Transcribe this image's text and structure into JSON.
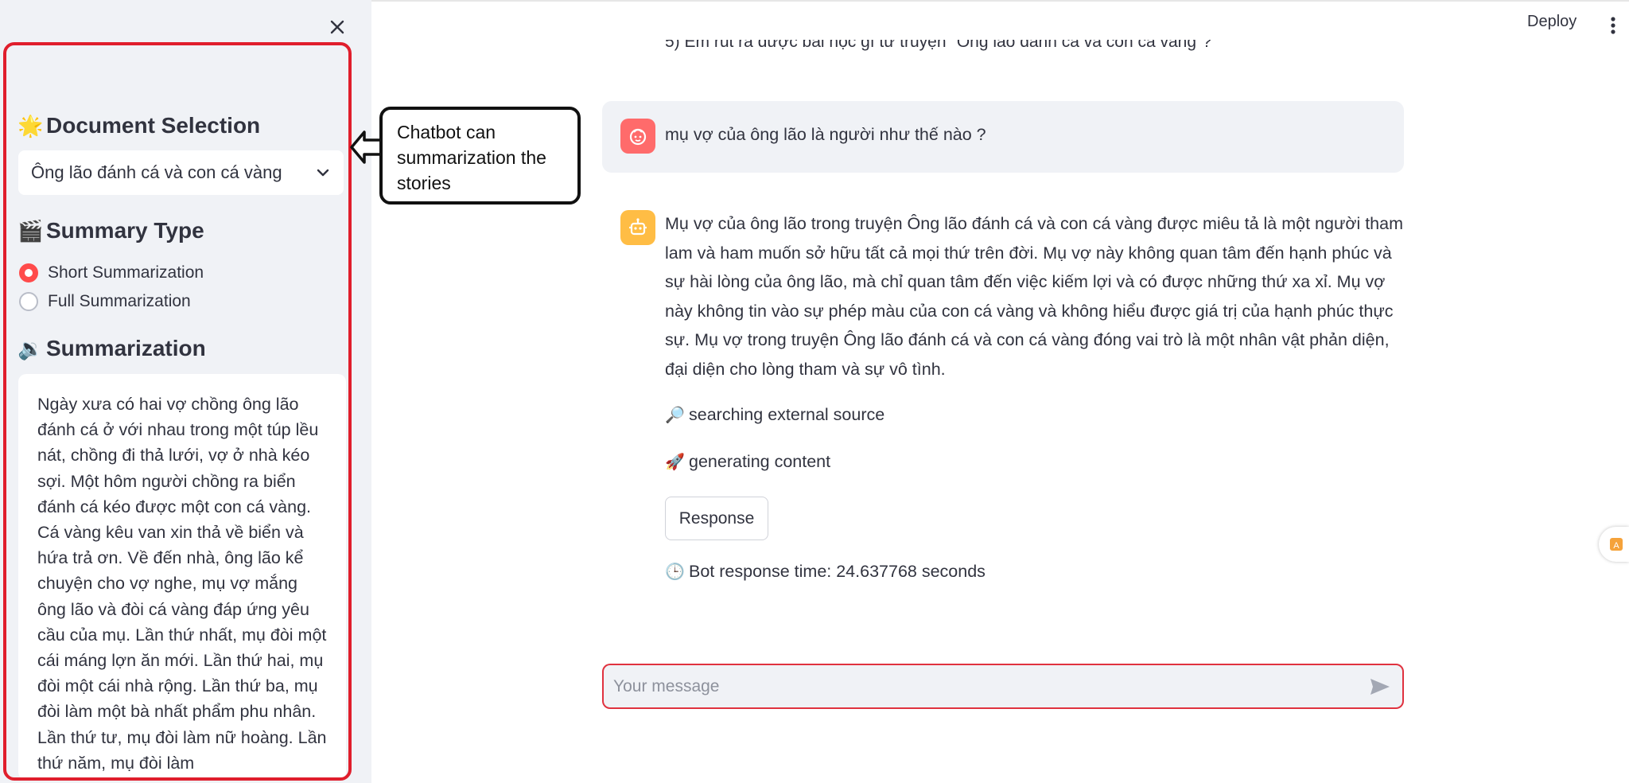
{
  "sidebar": {
    "document_heading": "Document Selection",
    "document_emoji": "🌟",
    "selected_document": "Ông lão đánh cá và con cá vàng",
    "summary_type_heading": "Summary Type",
    "summary_type_emoji": "🎬",
    "summary_type_options": [
      "Short Summarization",
      "Full Summarization"
    ],
    "summary_type_selected": "Short Summarization",
    "summarization_heading": "Summarization",
    "summarization_emoji": "🔉",
    "summary_text": "Ngày xưa có hai vợ chồng ông lão đánh cá ở với nhau trong một túp lều nát, chồng đi thả lưới, vợ ở nhà kéo sợi. Một hôm người chồng ra biển đánh cá kéo được một con cá vàng. Cá vàng kêu van xin thả về biển và hứa trả ơn. Về đến nhà, ông lão kể chuyện cho vợ nghe, mụ vợ mắng ông lão và đòi cá vàng đáp ứng yêu cầu của mụ. Lần thứ nhất, mụ đòi một cái máng lợn ăn mới. Lần thứ hai, mụ đòi một cái nhà rộng. Lần thứ ba, mụ đòi làm một bà nhất phẩm phu nhân. Lần thứ tư, mụ đòi làm nữ hoàng. Lần thứ năm, mụ đòi làm"
  },
  "header": {
    "deploy_label": "Deploy"
  },
  "chat": {
    "previous_line": "5) Em rút ra được bài học gì từ truyện \"Ông lão đánh cá và con cá vàng\"?",
    "user_message": "mụ vợ của ông lão là người như thế nào ?",
    "bot_message": "Mụ vợ của ông lão trong truyện Ông lão đánh cá và con cá vàng được miêu tả là một người tham lam và ham muốn sở hữu tất cả mọi thứ trên đời. Mụ vợ này không quan tâm đến hạnh phúc và sự hài lòng của ông lão, mà chỉ quan tâm đến việc kiếm lợi và có được những thứ xa xỉ. Mụ vợ này không tin vào sự phép màu của con cá vàng và không hiểu được giá trị của hạnh phúc thực sự. Mụ vợ trong truyện Ông lão đánh cá và con cá vàng đóng vai trò là một nhân vật phản diện, đại diện cho lòng tham và sự vô tình.",
    "status_searching": "searching external source",
    "status_searching_emoji": "🔎",
    "status_generating": "generating content",
    "status_generating_emoji": "🚀",
    "response_button": "Response",
    "response_time": "Bot response time: 24.637768 seconds",
    "response_time_emoji": "🕒",
    "input_placeholder": "Your message"
  },
  "annotation": {
    "callout_text": "Chatbot can summarization the stories"
  },
  "colors": {
    "accent": "#ff4b4b",
    "highlight": "#e01e2c",
    "sidebar_bg": "#f0f2f6",
    "user_avatar": "#ff6b6b",
    "bot_avatar": "#ffbd45"
  }
}
